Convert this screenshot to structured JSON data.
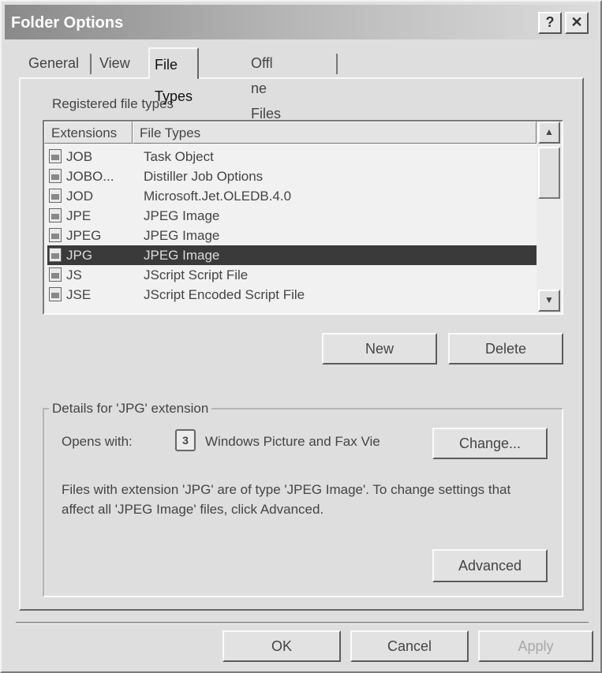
{
  "window": {
    "title": "Folder Options",
    "help_label": "?",
    "close_label": "✕"
  },
  "tabs": [
    {
      "label": "General"
    },
    {
      "label": "View"
    },
    {
      "label": "File Types"
    },
    {
      "label": "Offl ne Files"
    }
  ],
  "registered_label": "Registered file types",
  "list": {
    "columns": [
      "Extensions",
      "File Types"
    ],
    "rows": [
      {
        "ext": "JOB",
        "type": "Task Object"
      },
      {
        "ext": "JOBO...",
        "type": "Distiller Job Options"
      },
      {
        "ext": "JOD",
        "type": "Microsoft.Jet.OLEDB.4.0"
      },
      {
        "ext": "JPE",
        "type": "JPEG Image"
      },
      {
        "ext": "JPEG",
        "type": "JPEG Image"
      },
      {
        "ext": "JPG",
        "type": "JPEG Image"
      },
      {
        "ext": "JS",
        "type": "JScript Script File"
      },
      {
        "ext": "JSE",
        "type": "JScript Encoded Script File"
      }
    ],
    "selected_index": 5
  },
  "buttons": {
    "new": "New",
    "delete": "Delete",
    "change": "Change...",
    "advanced": "Advanced",
    "ok": "OK",
    "cancel": "Cancel",
    "apply": "Apply"
  },
  "details": {
    "title": "Details for 'JPG' extension",
    "opens_with_label": "Opens with:",
    "opens_with_app": "Windows Picture and Fax Vie",
    "description": "Files with extension 'JPG' are of type 'JPEG Image'. To change settings that affect all 'JPEG Image' files, click Advanced."
  }
}
